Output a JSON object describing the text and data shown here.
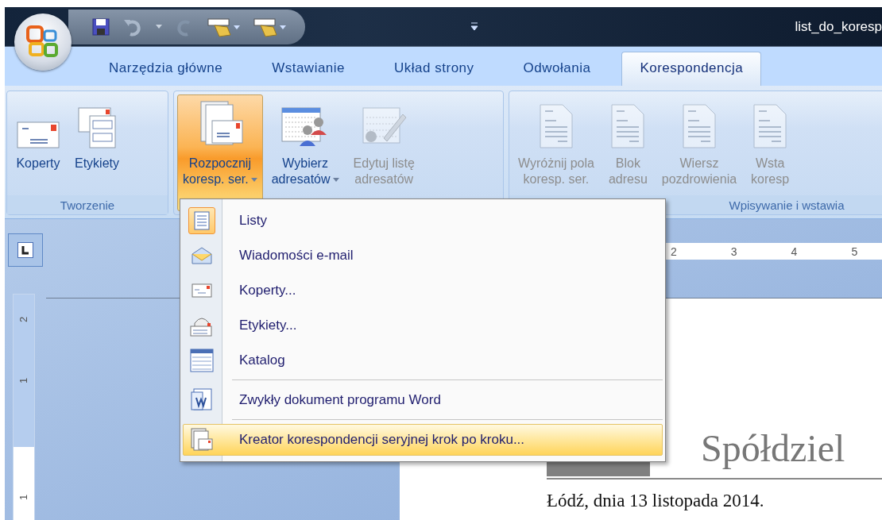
{
  "window": {
    "title": "list_do_koresp"
  },
  "tabs": [
    {
      "label": "Narzędzia główne",
      "selected": false
    },
    {
      "label": "Wstawianie",
      "selected": false
    },
    {
      "label": "Układ strony",
      "selected": false
    },
    {
      "label": "Odwołania",
      "selected": false
    },
    {
      "label": "Korespondencja",
      "selected": true
    }
  ],
  "ribbon": {
    "groups": [
      {
        "label": "Tworzenie",
        "buttons": [
          {
            "kind": "envelope",
            "lines": [
              "Koperty"
            ],
            "dropdown": false,
            "pressed": false,
            "disabled": false
          },
          {
            "kind": "labels",
            "lines": [
              "Etykiety"
            ],
            "dropdown": false,
            "pressed": false,
            "disabled": false
          }
        ]
      },
      {
        "buttons": [
          {
            "kind": "merge",
            "lines": [
              "Rozpocznij",
              "koresp. ser."
            ],
            "dropdown": true,
            "pressed": true,
            "disabled": false
          },
          {
            "kind": "recipients",
            "lines": [
              "Wybierz",
              "adresatów"
            ],
            "dropdown": true,
            "pressed": false,
            "disabled": false
          },
          {
            "kind": "edit-list",
            "lines": [
              "Edytuj listę",
              "adresatów"
            ],
            "dropdown": false,
            "pressed": false,
            "disabled": true
          }
        ]
      },
      {
        "label": "Wpisywanie i wstawia",
        "buttons": [
          {
            "kind": "document",
            "lines": [
              "Wyróżnij pola",
              "koresp. ser."
            ],
            "dropdown": false,
            "pressed": false,
            "disabled": true
          },
          {
            "kind": "document",
            "lines": [
              "Blok",
              "adresu"
            ],
            "dropdown": false,
            "pressed": false,
            "disabled": true
          },
          {
            "kind": "document",
            "lines": [
              "Wiersz",
              "pozdrowienia"
            ],
            "dropdown": false,
            "pressed": false,
            "disabled": true
          },
          {
            "kind": "document",
            "lines": [
              "Wsta",
              "koresp"
            ],
            "dropdown": false,
            "pressed": false,
            "disabled": true
          }
        ]
      }
    ]
  },
  "menu": {
    "items": [
      {
        "kind": "letter",
        "label": "Listy",
        "checked": true,
        "selected": false,
        "separator_before": false
      },
      {
        "kind": "email",
        "label": "Wiadomości e-mail",
        "checked": false,
        "selected": false,
        "separator_before": false
      },
      {
        "kind": "envelope",
        "label": "Koperty...",
        "checked": false,
        "selected": false,
        "separator_before": false
      },
      {
        "kind": "labels",
        "label": "Etykiety...",
        "checked": false,
        "selected": false,
        "separator_before": false
      },
      {
        "kind": "catalog",
        "label": "Katalog",
        "checked": false,
        "selected": false,
        "separator_before": false
      },
      {
        "kind": "word",
        "label": "Zwykły dokument programu Word",
        "checked": false,
        "selected": false,
        "separator_before": true
      },
      {
        "kind": "wizard",
        "label": "Kreator korespondencji seryjnej krok po kroku...",
        "checked": false,
        "selected": true,
        "separator_before": true
      }
    ]
  },
  "horizontal_ruler": {
    "numbers": [
      "2",
      "3",
      "4",
      "5"
    ]
  },
  "vertical_ruler": {
    "numbers": [
      "2",
      "1",
      "1"
    ]
  },
  "document": {
    "heading": "Spółdziel",
    "date_line": "Łódź, dnia 13 listopada 2014."
  }
}
